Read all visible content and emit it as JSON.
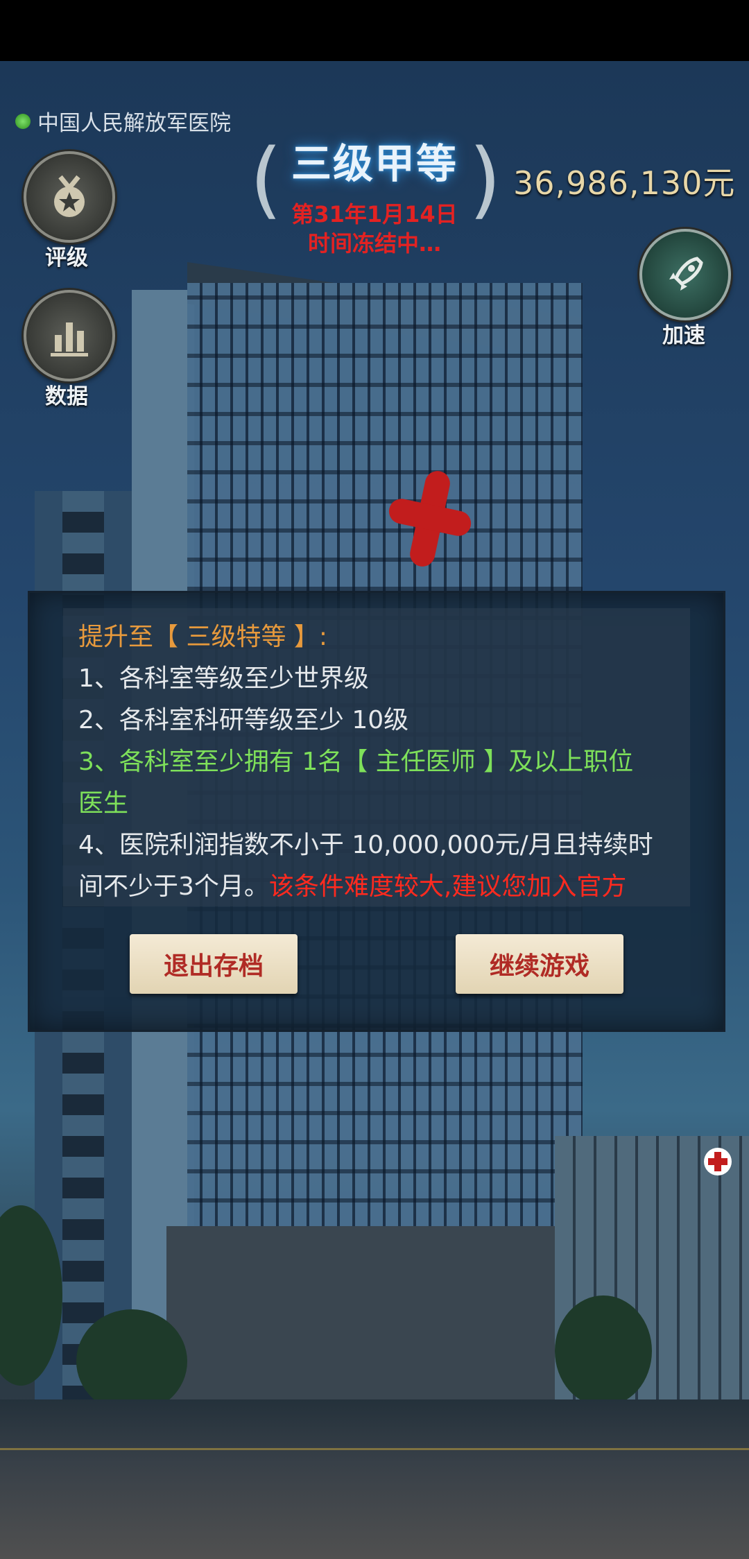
{
  "hospital_name": "中国人民解放军医院",
  "rank": "三级甲等",
  "date": "第31年1月14日",
  "status": "时间冻结中…",
  "money": "36,986,130元",
  "buttons": {
    "rating": "评级",
    "data": "数据",
    "speed": "加速"
  },
  "dialog": {
    "title": "提升至【 三级特等 】:",
    "req1": "1、各科室等级至少世界级",
    "req2": "2、各科室科研等级至少 10级",
    "req3_line1": "3、各科室至少拥有 1名【 主任医师 】及以上职位",
    "req3_line2": "医生",
    "req4_line1": "4、医院利润指数不小于 10,000,000元/月且持续时",
    "req4_line2_a": "间不少于3个月。",
    "req4_line2_b": "该条件难度较大,建议您加入官方",
    "quit_button": "退出存档",
    "continue_button": "继续游戏"
  },
  "colors": {
    "title_text": "#e89a3c",
    "normal_text": "#e6e9ec",
    "met_text": "#7ee05a",
    "warning_text": "#ff2a1f",
    "button_text": "#b02b25"
  }
}
